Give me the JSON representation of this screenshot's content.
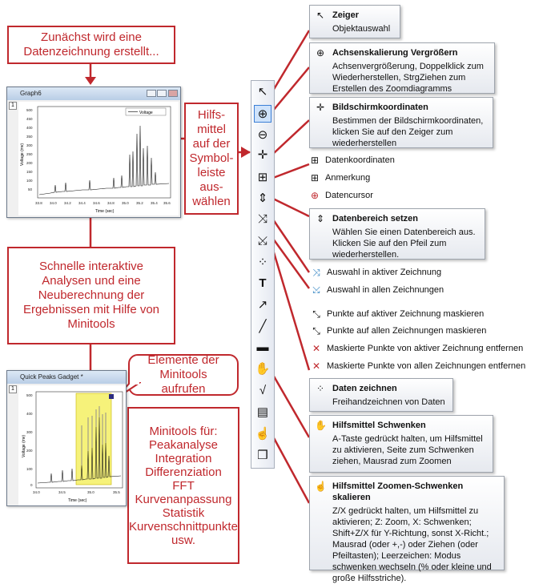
{
  "callouts": {
    "step1": "Zunächst wird eine Datenzeichnung erstellt...",
    "step2_lines": [
      "Hilfs-",
      "mittel",
      "auf der",
      "Symbol-",
      "leiste",
      "aus-",
      "wählen"
    ],
    "step3": "Schnelle interaktive Analysen und eine Neuberechnung der Ergebnissen mit Hilfe von Minitools",
    "step4": "Elemente der Minitools aufrufen",
    "minitools_lines": [
      "Minitools für:",
      "Peakanalyse",
      "Integration",
      "Differenziation",
      "FFT",
      "Kurvenanpassung",
      "Statistik",
      "Kurvenschnittpunkte",
      "usw."
    ]
  },
  "graph6": {
    "title": "Graph6",
    "tab": "1",
    "legend": "Voltage",
    "ylabel": "Voltage (mv)",
    "xlabel": "Time (sec)",
    "yticks": [
      "500",
      "450",
      "400",
      "350",
      "300",
      "250",
      "200",
      "150",
      "100",
      "50"
    ],
    "xticks": [
      "33.8",
      "34.0",
      "34.2",
      "34.4",
      "34.6",
      "34.8",
      "35.0",
      "35.2",
      "35.4",
      "35.6"
    ]
  },
  "gadget": {
    "title": "Quick Peaks Gadget *",
    "tab": "1",
    "ylabel": "Voltage (mv)",
    "xlabel": "Time (sec)",
    "yticks": [
      "500",
      "400",
      "300",
      "200",
      "100",
      "0"
    ],
    "xticks": [
      "34.0",
      "34.5",
      "35.0",
      "35.5"
    ]
  },
  "tooltips": [
    {
      "icon": "pointer-icon",
      "title": "Zeiger",
      "desc": "Objektauswahl"
    },
    {
      "icon": "zoom-in-icon",
      "title": "Achsenskalierung Vergrößern",
      "desc": "Achsenvergrößerung, Doppelklick zum Wiederherstellen, StrgZiehen zum Erstellen des Zoomdiagramms"
    },
    {
      "icon": "crosshair-icon",
      "title": "Bildschirmkoordinaten",
      "desc": "Bestimmen der Bildschirmkoordinaten, klicken Sie auf den Zeiger zum wiederherstellen"
    },
    {
      "icon": "data-range-icon",
      "title": "Datenbereich setzen",
      "desc": "Wählen Sie einen Datenbereich aus. Klicken Sie auf den Pfeil zum wiederherstellen."
    },
    {
      "icon": "draw-data-icon",
      "title": "Daten zeichnen",
      "desc": "Freihandzeichnen von Daten"
    },
    {
      "icon": "hand-pan-icon",
      "title": "Hilfsmittel Schwenken",
      "desc": "A-Taste gedrückt halten, um Hilfsmittel zu aktivieren, Seite zum Schwenken ziehen, Mausrad zum Zoomen"
    },
    {
      "icon": "zoom-pan-icon",
      "title": "Hilfsmittel Zoomen-Schwenken skalieren",
      "desc": "Z/X gedrückt halten, um Hilfsmittel zu aktivieren; Z: Zoom, X: Schwenken; Shift+Z/X für Y-Richtung, sonst X-Richt.; Mausrad (oder +,-) oder Ziehen (oder Pfeiltasten); Leerzeichen: Modus schwenken wechseln (% oder kleine und große Hilfsstriche)."
    }
  ],
  "plain_items": [
    {
      "icon": "data-coordinates-icon",
      "label": "Datenkoordinaten"
    },
    {
      "icon": "annotation-icon",
      "label": "Anmerkung"
    },
    {
      "icon": "data-cursor-icon",
      "label": "Datencursor"
    },
    {
      "icon": "select-active-icon",
      "label": "Auswahl in aktiver Zeichnung"
    },
    {
      "icon": "select-all-icon",
      "label": "Auswahl in allen Zeichnungen"
    },
    {
      "icon": "mask-active-icon",
      "label": "Punkte auf aktiver Zeichnung maskieren"
    },
    {
      "icon": "mask-all-icon",
      "label": "Punkte auf allen Zeichnungen maskieren"
    },
    {
      "icon": "remove-mask-active-icon",
      "label": "Maskierte Punkte von aktiver Zeichnung entfernen"
    },
    {
      "icon": "remove-mask-all-icon",
      "label": "Maskierte Punkte von allen Zeichnungen entfernen"
    }
  ],
  "colors": {
    "callout_red": "#c0282d",
    "toolbar_bg": "#e8ecf3",
    "selection_yellow": "#f6f27a"
  }
}
